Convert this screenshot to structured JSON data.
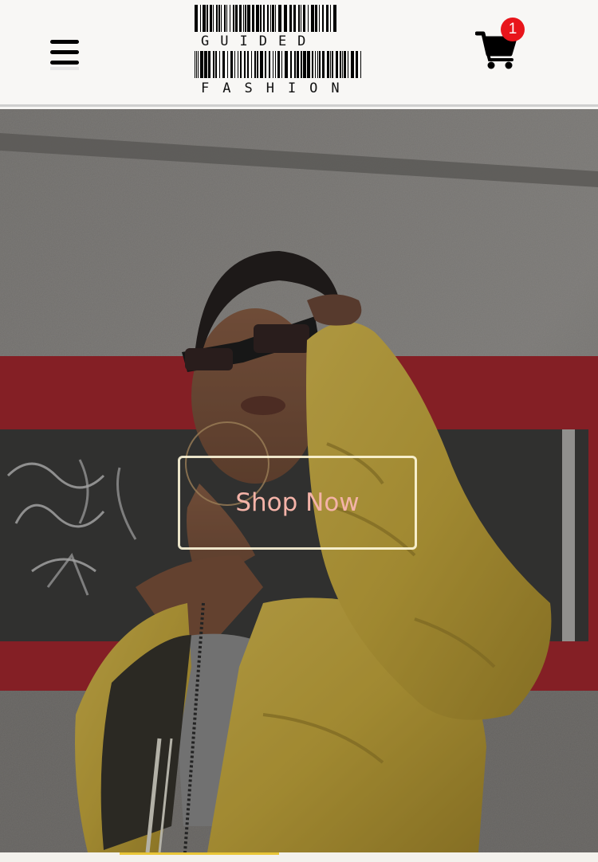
{
  "header": {
    "menu_icon": "hamburger-menu-icon",
    "logo": {
      "line1": "GUIDED",
      "line2": "FASHION",
      "style": "barcode"
    },
    "cart": {
      "icon": "shopping-cart-icon",
      "count": "1",
      "badge_color": "#e8151b"
    }
  },
  "hero": {
    "cta_label": "Shop Now",
    "cta_text_color": "#f4b3a8",
    "jacket_color": "#d8b53c",
    "frame_color": "#a81d24"
  }
}
